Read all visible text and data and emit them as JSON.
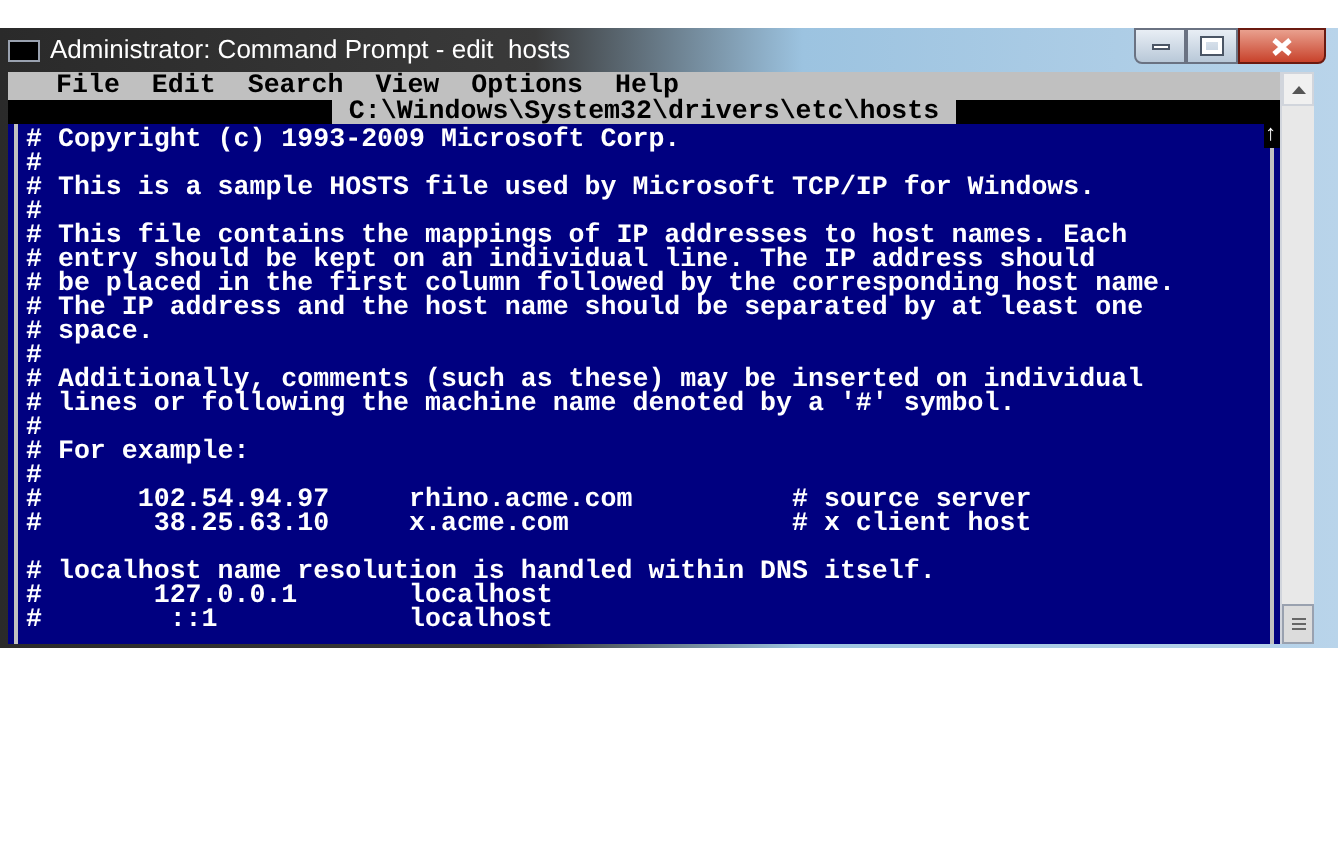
{
  "window": {
    "title": "Administrator: Command Prompt - edit  hosts"
  },
  "menu": [
    "File",
    "Edit",
    "Search",
    "View",
    "Options",
    "Help"
  ],
  "file_path": "C:\\Windows\\System32\\drivers\\etc\\hosts",
  "scroll_arrow": "↑",
  "blocks": [
    [
      "# Copyright (c) 1993-2009 Microsoft Corp.",
      "#",
      "# This is a sample HOSTS file used by Microsoft TCP/IP for Windows.",
      "#",
      "# This file contains the mappings of IP addresses to host names. Each",
      "# entry should be kept on an individual line. The IP address should",
      "# be placed in the first column followed by the corresponding host name.",
      "# The IP address and the host name should be separated by at least one",
      "# space.",
      "#",
      "# Additionally, comments (such as these) may be inserted on individual",
      "# lines or following the machine name denoted by a '#' symbol.",
      "#",
      "# For example:",
      "#",
      "#      102.54.94.97     rhino.acme.com          # source server",
      "#       38.25.63.10     x.acme.com              # x client host"
    ],
    [
      "# localhost name resolution is handled within DNS itself.",
      "#       127.0.0.1       localhost",
      "#        ::1            localhost"
    ]
  ]
}
